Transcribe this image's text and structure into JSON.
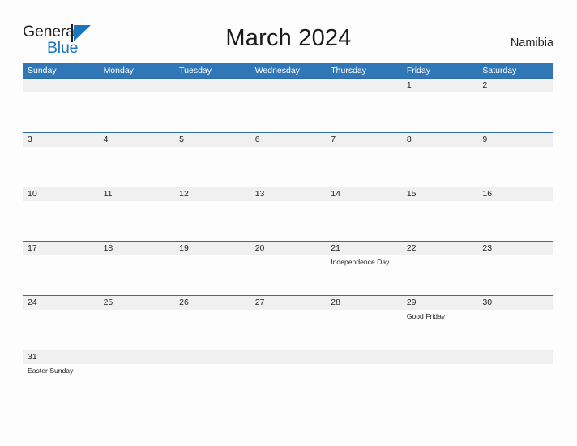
{
  "brand": {
    "name_part1": "General",
    "name_part2": "Blue",
    "mark_icon": "flag-triangle-icon"
  },
  "header": {
    "title": "March 2024",
    "region": "Namibia"
  },
  "colors": {
    "header_blue": "#3077b8",
    "row_rule_blue": "#2d6ca8",
    "number_band_gray": "#f0f0f0",
    "brand_blue": "#1b75bb",
    "page_background": "#fdfdfd",
    "text": "#231f20"
  },
  "calendar": {
    "day_headers": [
      "Sunday",
      "Monday",
      "Tuesday",
      "Wednesday",
      "Thursday",
      "Friday",
      "Saturday"
    ],
    "weeks": [
      {
        "days": [
          {
            "num": "",
            "event": ""
          },
          {
            "num": "",
            "event": ""
          },
          {
            "num": "",
            "event": ""
          },
          {
            "num": "",
            "event": ""
          },
          {
            "num": "",
            "event": ""
          },
          {
            "num": "1",
            "event": ""
          },
          {
            "num": "2",
            "event": ""
          }
        ]
      },
      {
        "days": [
          {
            "num": "3",
            "event": ""
          },
          {
            "num": "4",
            "event": ""
          },
          {
            "num": "5",
            "event": ""
          },
          {
            "num": "6",
            "event": ""
          },
          {
            "num": "7",
            "event": ""
          },
          {
            "num": "8",
            "event": ""
          },
          {
            "num": "9",
            "event": ""
          }
        ]
      },
      {
        "days": [
          {
            "num": "10",
            "event": ""
          },
          {
            "num": "11",
            "event": ""
          },
          {
            "num": "12",
            "event": ""
          },
          {
            "num": "13",
            "event": ""
          },
          {
            "num": "14",
            "event": ""
          },
          {
            "num": "15",
            "event": ""
          },
          {
            "num": "16",
            "event": ""
          }
        ]
      },
      {
        "days": [
          {
            "num": "17",
            "event": ""
          },
          {
            "num": "18",
            "event": ""
          },
          {
            "num": "19",
            "event": ""
          },
          {
            "num": "20",
            "event": ""
          },
          {
            "num": "21",
            "event": "Independence Day"
          },
          {
            "num": "22",
            "event": ""
          },
          {
            "num": "23",
            "event": ""
          }
        ]
      },
      {
        "days": [
          {
            "num": "24",
            "event": ""
          },
          {
            "num": "25",
            "event": ""
          },
          {
            "num": "26",
            "event": ""
          },
          {
            "num": "27",
            "event": ""
          },
          {
            "num": "28",
            "event": ""
          },
          {
            "num": "29",
            "event": "Good Friday"
          },
          {
            "num": "30",
            "event": ""
          }
        ]
      },
      {
        "days": [
          {
            "num": "31",
            "event": "Easter Sunday"
          },
          {
            "num": "",
            "event": ""
          },
          {
            "num": "",
            "event": ""
          },
          {
            "num": "",
            "event": ""
          },
          {
            "num": "",
            "event": ""
          },
          {
            "num": "",
            "event": ""
          },
          {
            "num": "",
            "event": ""
          }
        ]
      }
    ]
  }
}
